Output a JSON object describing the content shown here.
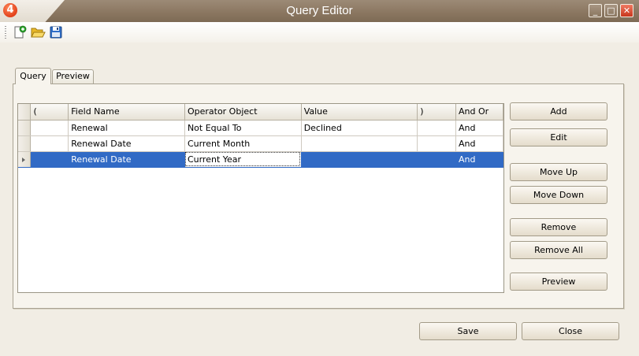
{
  "window": {
    "title": "Query Editor",
    "logo_text": "4",
    "controls": {
      "minimize": "_",
      "maximize": "□",
      "close": "✕"
    }
  },
  "toolbar": {
    "items": [
      {
        "name": "new-query",
        "icon": "new-document-icon"
      },
      {
        "name": "open-query",
        "icon": "folder-open-icon"
      },
      {
        "name": "save-query",
        "icon": "floppy-disk-icon"
      }
    ]
  },
  "tabs": [
    {
      "label": "Query",
      "active": true
    },
    {
      "label": "Preview",
      "active": false
    }
  ],
  "grid": {
    "columns": [
      "(",
      "Field Name",
      "Operator Object",
      "Value",
      ")",
      "And Or"
    ],
    "rows": [
      {
        "open_paren": "",
        "field": "Renewal",
        "operator": "Not Equal To",
        "value": "Declined",
        "close_paren": "",
        "and_or": "And",
        "selected": false
      },
      {
        "open_paren": "",
        "field": "Renewal Date",
        "operator": "Current Month",
        "value": "",
        "close_paren": "",
        "and_or": "And",
        "selected": false
      },
      {
        "open_paren": "",
        "field": "Renewal Date",
        "operator": "Current Year",
        "value": "",
        "close_paren": "",
        "and_or": "And",
        "selected": true
      }
    ]
  },
  "actions": {
    "add": "Add",
    "edit": "Edit",
    "move_up": "Move Up",
    "move_down": "Move Down",
    "remove": "Remove",
    "remove_all": "Remove All",
    "preview": "Preview"
  },
  "footer": {
    "save": "Save",
    "close": "Close"
  },
  "colors": {
    "titlebar": "#8a7660",
    "selection": "#316ac5",
    "window_bg": "#f1ede4"
  }
}
